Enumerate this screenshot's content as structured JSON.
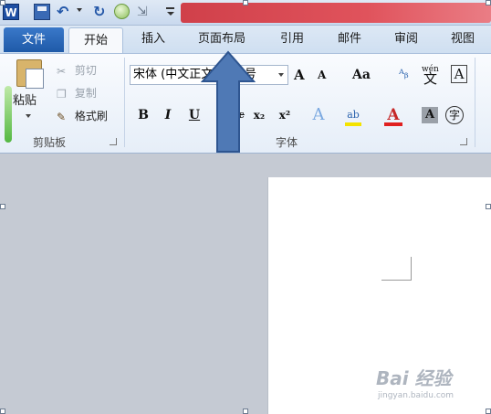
{
  "title_bar": {
    "app_icon": "word-icon",
    "app_icon_letter": "W",
    "quick_access": [
      "save-icon",
      "undo-icon",
      "redo-icon",
      "circle-icon",
      "format-icon",
      "customize-icon"
    ]
  },
  "tabs": [
    {
      "label": "文件"
    },
    {
      "label": "开始"
    },
    {
      "label": "插入"
    },
    {
      "label": "页面布局"
    },
    {
      "label": "引用"
    },
    {
      "label": "邮件"
    },
    {
      "label": "审阅"
    },
    {
      "label": "视图"
    }
  ],
  "clipboard": {
    "paste_label": "粘贴",
    "cut_label": "剪切",
    "copy_label": "复制",
    "painter_label": "格式刷",
    "group_label": "剪贴板"
  },
  "font": {
    "font_name": "宋体 (中文正文)",
    "font_size": "五号",
    "grow": "A",
    "shrink": "A",
    "change_case": "Aa",
    "bold": "B",
    "italic": "I",
    "underline": "U",
    "strike": "abc",
    "subscript": "x₂",
    "superscript": "x²",
    "enclose": "字",
    "phonetic": "wén",
    "phonetic_base": "文",
    "highlight": "ab",
    "color_letter": "A",
    "shade_letter": "A",
    "border_letter": "A",
    "group_label": "字体"
  },
  "colors": {
    "file_tab": "#2a67b8",
    "arrow": "#4f79b5",
    "font_color_bar": "#e02020",
    "highlight_bar": "#f4e300",
    "redaction": "#d94a54"
  },
  "watermark": {
    "text": "Bai 经验",
    "url": "jingyan.baidu.com"
  }
}
